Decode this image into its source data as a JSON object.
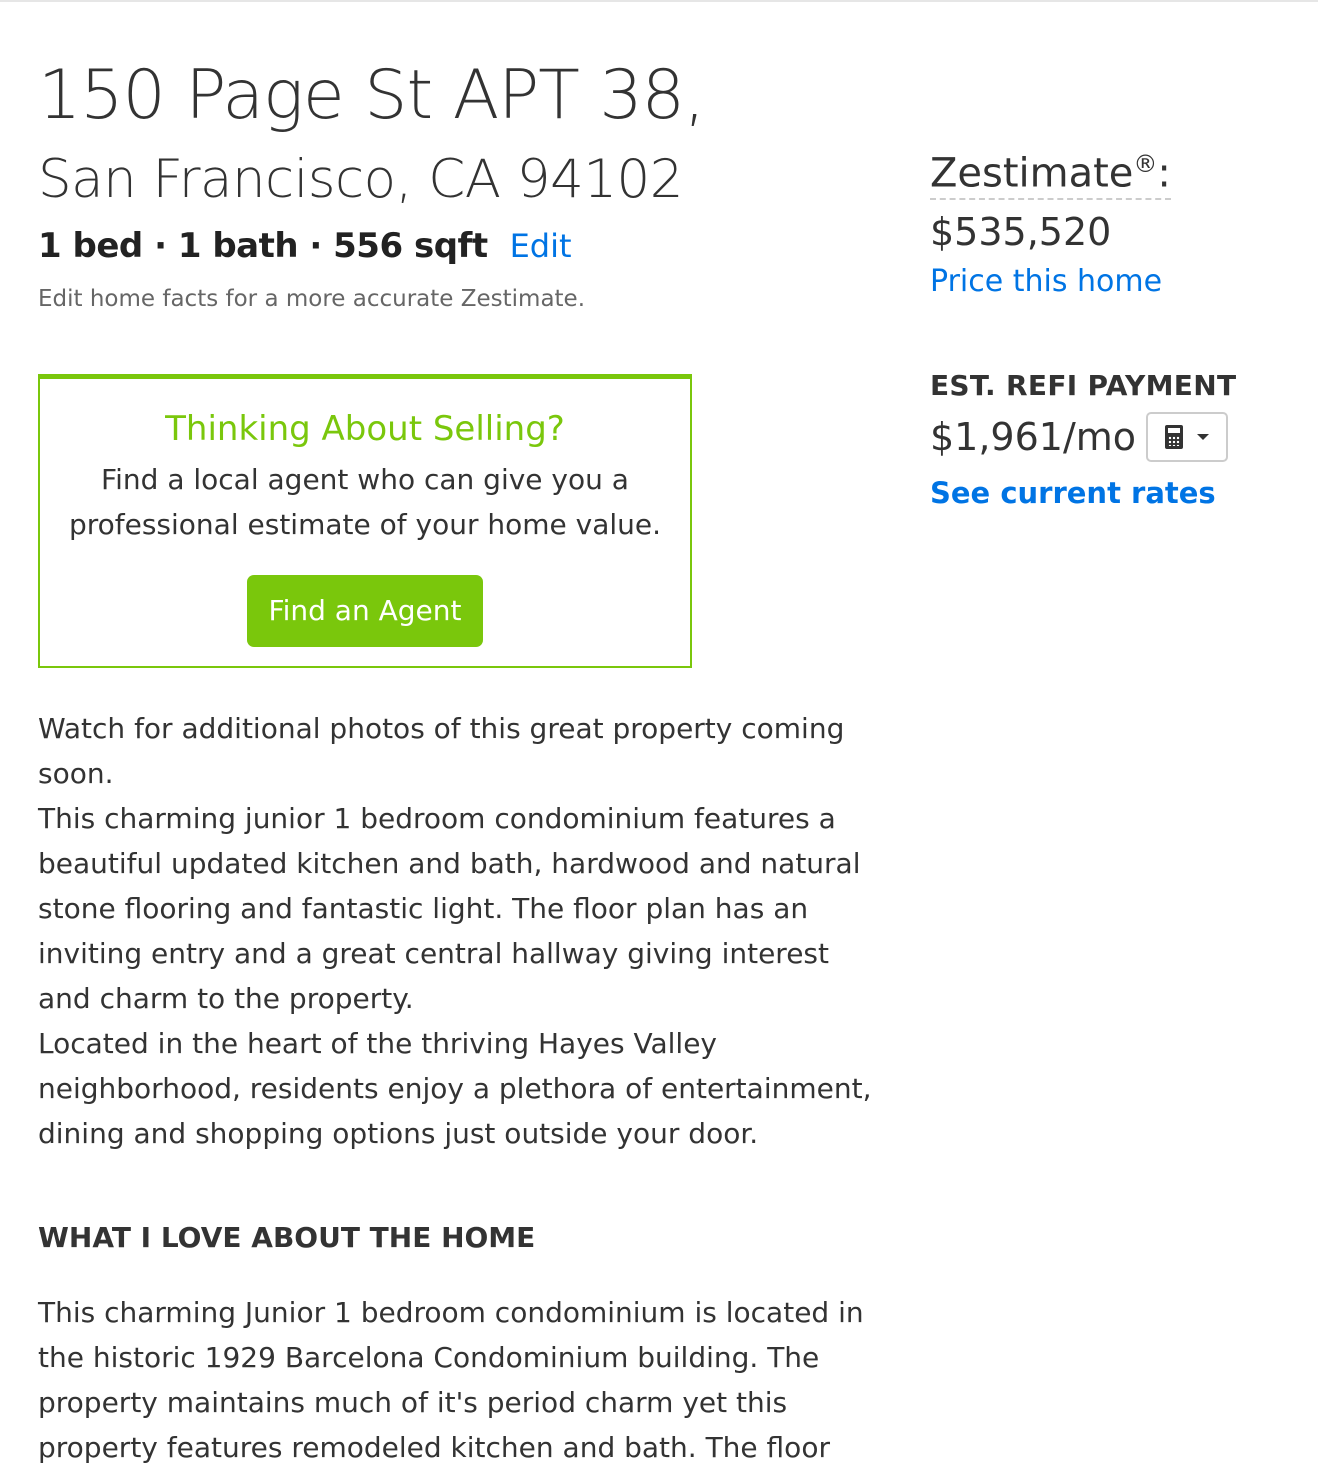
{
  "address": {
    "line1": "150 Page St APT 38,",
    "line2": "San Francisco, CA 94102"
  },
  "facts": {
    "summary": "1 bed · 1 bath · 556 sqft",
    "edit_label": "Edit",
    "hint": "Edit home facts for a more accurate Zestimate."
  },
  "selling": {
    "title": "Thinking About Selling?",
    "text": "Find a local agent who can give you a professional estimate of your home value.",
    "button_label": "Find an Agent"
  },
  "description": {
    "p1": "Watch for additional photos of this great property coming soon.",
    "p2": "This charming junior 1 bedroom condominium features a beautiful updated kitchen and bath, hardwood and natural stone flooring and fantastic light. The floor plan has an inviting entry and a great central hallway giving interest and charm to the property.",
    "p3": "Located in the heart of the thriving Hayes Valley neighborhood, residents enjoy a plethora of entertainment, dining and shopping options just outside your door."
  },
  "love": {
    "heading": "WHAT I LOVE ABOUT THE HOME",
    "text": "This charming Junior 1 bedroom condominium is located in the historic 1929 Barcelona Condominium building. The property maintains much of it's period charm yet this property features remodeled kitchen and bath. The floor"
  },
  "sidebar": {
    "zestimate_label": "Zestimate",
    "zestimate_reg": "®",
    "zestimate_colon": ":",
    "zestimate_value": "$535,520",
    "price_link": "Price this home",
    "refi_label": "EST. REFI PAYMENT",
    "refi_value": "$1,961/mo",
    "calc_icon": "calculator-icon",
    "rates_link": "See current rates"
  },
  "colors": {
    "accent_green": "#7ac70c",
    "link_blue": "#0074e4"
  }
}
